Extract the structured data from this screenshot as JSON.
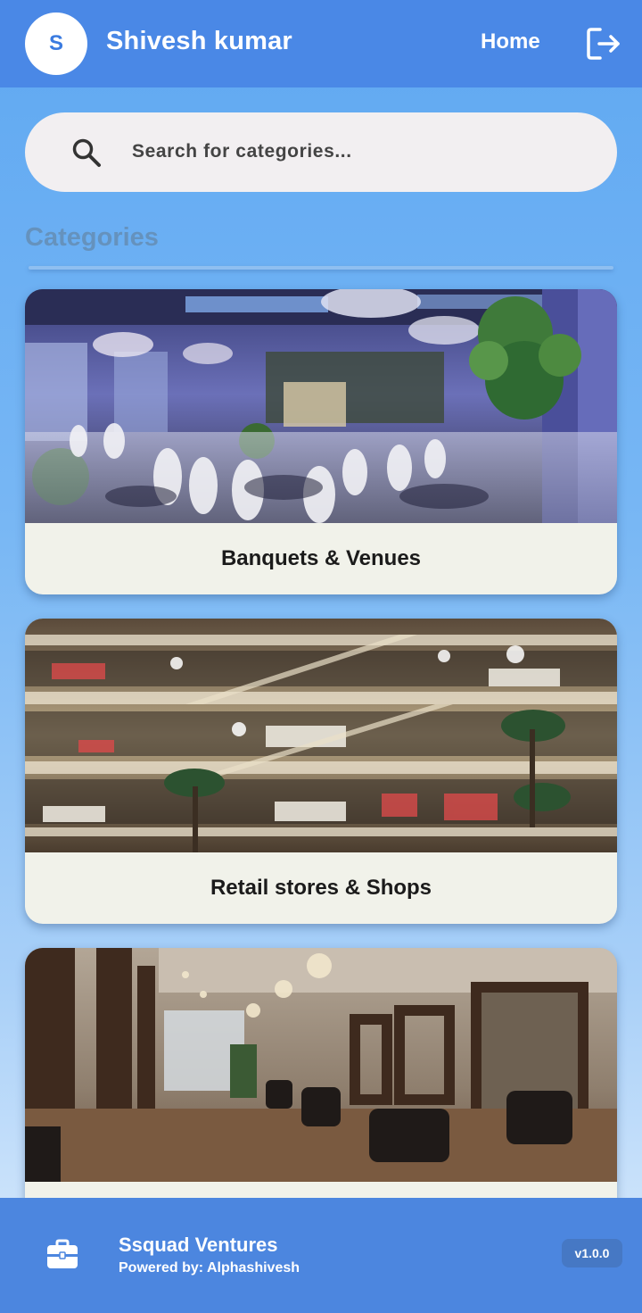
{
  "header": {
    "avatar_initial": "S",
    "username": "Shivesh kumar",
    "home_label": "Home",
    "logout_icon": "logout-icon"
  },
  "search": {
    "placeholder": "Search for categories...",
    "icon": "search-icon"
  },
  "categories": {
    "title": "Categories",
    "items": [
      {
        "label": "Banquets & Venues",
        "image": "banquet-hall-photo"
      },
      {
        "label": "Retail stores & Shops",
        "image": "shopping-mall-photo"
      },
      {
        "label": "",
        "image": "salon-interior-photo"
      }
    ]
  },
  "footer": {
    "icon": "briefcase-icon",
    "company": "Ssquad Ventures",
    "powered_by": "Powered by: Alphashivesh",
    "version": "v1.0.0"
  },
  "colors": {
    "appbar": "#4a88e6",
    "footer": "#4c86df",
    "accent": "#3b7be0",
    "section_title": "#6592bd"
  }
}
